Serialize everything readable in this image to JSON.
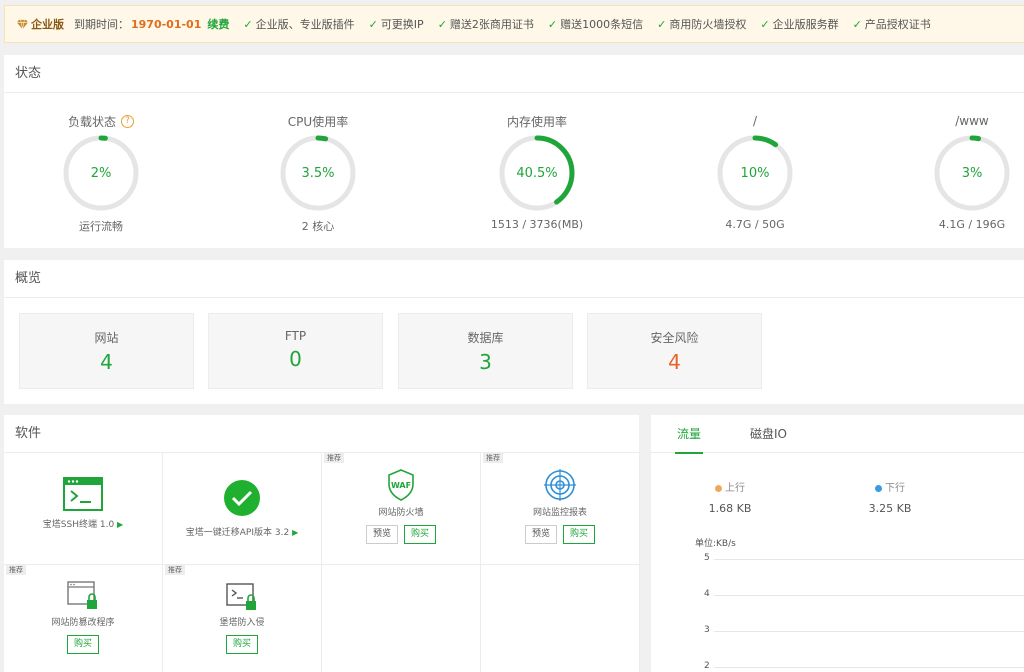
{
  "banner": {
    "edition": "企业版",
    "expire_label": "到期时间：",
    "expire_date": "1970-01-01",
    "renew": "续费",
    "features": [
      "企业版、专业版插件",
      "可更换IP",
      "赠送2张商用证书",
      "赠送1000条短信",
      "商用防火墙授权",
      "企业版服务群",
      "产品授权证书"
    ]
  },
  "status": {
    "title": "状态",
    "gauges": [
      {
        "title": "负载状态",
        "value": "2%",
        "percent": 2,
        "footer": "运行流畅",
        "help": "?"
      },
      {
        "title": "CPU使用率",
        "value": "3.5%",
        "percent": 3.5,
        "footer": "2 核心"
      },
      {
        "title": "内存使用率",
        "value": "40.5%",
        "percent": 40.5,
        "footer": "1513 / 3736(MB)"
      },
      {
        "title": "/",
        "value": "10%",
        "percent": 10,
        "footer": "4.7G / 50G"
      },
      {
        "title": "/www",
        "value": "3%",
        "percent": 3,
        "footer": "4.1G / 196G"
      }
    ]
  },
  "overview": {
    "title": "概览",
    "cards": [
      {
        "label": "网站",
        "value": "4"
      },
      {
        "label": "FTP",
        "value": "0"
      },
      {
        "label": "数据库",
        "value": "3"
      },
      {
        "label": "安全风险",
        "value": "4"
      }
    ]
  },
  "software": {
    "title": "软件",
    "items": [
      {
        "name": "宝塔SSH终端 1.0",
        "icon": "terminal-window-icon",
        "has_arrow": true
      },
      {
        "name": "宝塔一键迁移API版本 3.2",
        "icon": "check-circle-icon",
        "has_arrow": true
      },
      {
        "name": "网站防火墙",
        "icon": "waf-shield-icon",
        "tag": "推荐",
        "icon_text": "WAF",
        "buttons": [
          "预览",
          "购买"
        ]
      },
      {
        "name": "网站监控报表",
        "icon": "target-monitor-icon",
        "tag": "推荐",
        "buttons": [
          "预览",
          "购买"
        ]
      },
      {
        "name": "网站防篡改程序",
        "icon": "locked-browser-icon",
        "tag": "推荐",
        "buttons": [
          "购买"
        ]
      },
      {
        "name": "堡塔防入侵",
        "icon": "locked-terminal-icon",
        "tag": "推荐",
        "buttons": [
          "购买"
        ]
      }
    ]
  },
  "traffic": {
    "tabs": [
      "流量",
      "磁盘IO"
    ],
    "up_label": "上行",
    "up_value": "1.68 KB",
    "down_label": "下行",
    "down_value": "3.25 KB",
    "unit": "单位:KB/s",
    "y_ticks": [
      "5",
      "4",
      "3",
      "2"
    ]
  },
  "colors": {
    "accent": "#20a53a",
    "warn": "#e8622a",
    "up_dot": "#f0a860",
    "down_dot": "#3a9be0"
  }
}
